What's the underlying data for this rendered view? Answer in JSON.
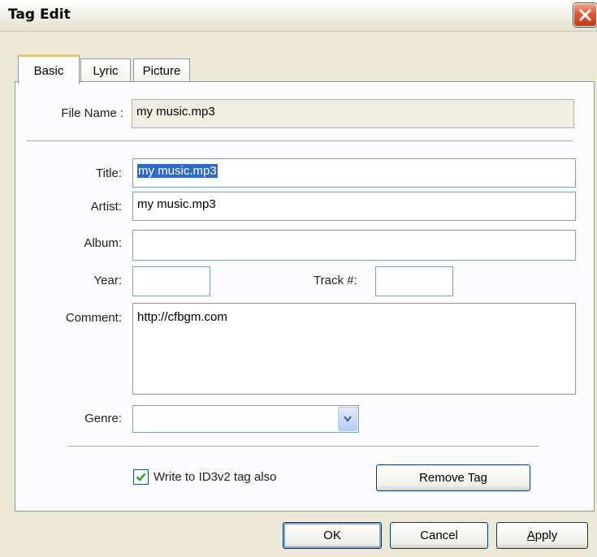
{
  "window": {
    "title": "Tag Edit"
  },
  "tabs": [
    {
      "label": "Basic"
    },
    {
      "label": "Lyric"
    },
    {
      "label": "Picture"
    }
  ],
  "file": {
    "label": "File Name :",
    "value": "my music.mp3"
  },
  "fields": {
    "title": {
      "label": "Title:",
      "value": "my music.mp3"
    },
    "artist": {
      "label": "Artist:",
      "value": "my music.mp3"
    },
    "album": {
      "label": "Album:",
      "value": ""
    },
    "year": {
      "label": "Year:",
      "value": ""
    },
    "track": {
      "label": "Track #:",
      "value": ""
    },
    "comment": {
      "label": "Comment:",
      "value": "http://cfbgm.com"
    },
    "genre": {
      "label": "Genre:",
      "value": ""
    }
  },
  "options": {
    "write_id3v2_label": "Write to ID3v2 tag also",
    "write_id3v2_checked": true
  },
  "buttons": {
    "remove_tag": "Remove Tag",
    "ok": "OK",
    "cancel": "Cancel",
    "apply_pre": "",
    "apply_ul": "A",
    "apply_post": "pply"
  },
  "icons": {
    "close": "close-icon",
    "dropdown": "chevron-down-icon",
    "check": "checkmark-icon"
  },
  "colors": {
    "selection": "#316ac5",
    "active_tab_accent": "#ffc83c",
    "close_button": "#e1572f"
  }
}
